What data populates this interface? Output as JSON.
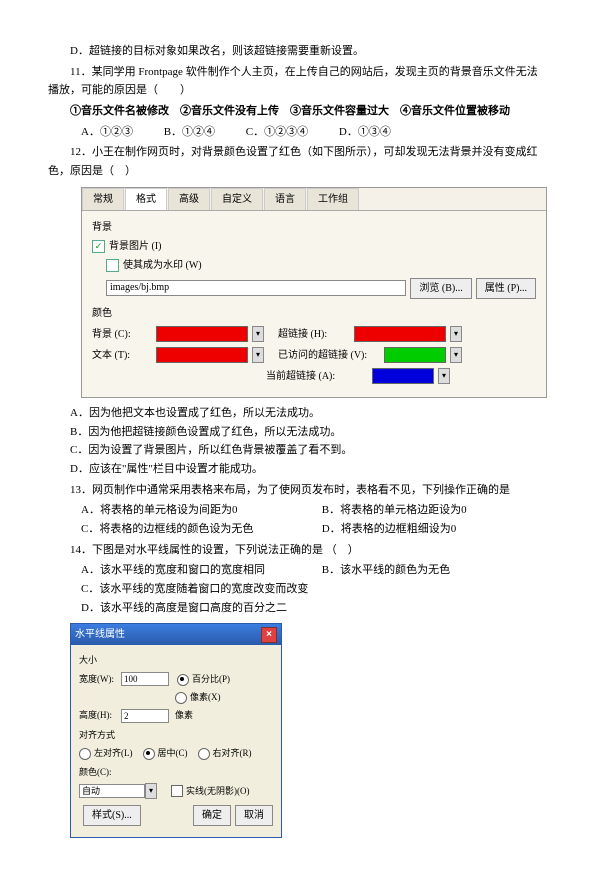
{
  "q10_d": "D．超链接的目标对象如果改名，则该超链接需要重新设置。",
  "q11": "11．某同学用 Frontpage 软件制作个人主页，在上传自己的网站后，发现主页的背景音乐文件无法播放，可能的原因是（　　）",
  "q11_conds": "①音乐文件名被修改　②音乐文件没有上传　③音乐文件容量过大　④音乐文件位置被移动",
  "q11a": "A．①②③",
  "q11b": "B．①②④",
  "q11c": "C．①②③④",
  "q11d": "D．①③④",
  "q12": "12．小王在制作网页时，对背景颜色设置了红色（如下图所示），可却发现无法背景并没有变成红色，原因是（　）",
  "tabs": {
    "t1": "常规",
    "t2": "格式",
    "t3": "高级",
    "t4": "自定义",
    "t5": "语言",
    "t6": "工作组"
  },
  "pane": {
    "sec": "背景",
    "chk1": "背景图片 (I)",
    "chk2": "使其成为水印 (W)",
    "img": "images/bj.bmp",
    "browse": "浏览 (B)...",
    "prop": "属性 (P)...",
    "colors": "颜色",
    "bg": "背景 (C):",
    "hl": "超链接 (H):",
    "txt": "文本 (T):",
    "vis": "已访问的超链接 (V):",
    "act": "当前超链接 (A):"
  },
  "q12a": "A．因为他把文本也设置成了红色，所以无法成功。",
  "q12b": "B．因为他把超链接颜色设置成了红色，所以无法成功。",
  "q12c": "C．因为设置了背景图片，所以红色背景被覆盖了看不到。",
  "q12d": "D．应该在\"属性\"栏目中设置才能成功。",
  "q13": "13．网页制作中通常采用表格来布局，为了使网页发布时，表格看不见，下列操作正确的是",
  "q13a": "A．将表格的单元格设为间距为0",
  "q13b": "B．将表格的单元格边距设为0",
  "q13c": "C．将表格的边框线的颜色设为无色",
  "q13d": "D．将表格的边框粗细设为0",
  "q14": "14．下图是对水平线属性的设置，下列说法正确的是 （　）",
  "q14a": "A．该水平线的宽度和窗口的宽度相同",
  "q14b": "B．该水平线的颜色为无色",
  "q14c": "C．该水平线的宽度随着窗口的宽度改变而改变",
  "q14d": "D．该水平线的高度是窗口高度的百分之二",
  "dlg": {
    "title": "水平线属性",
    "size": "大小",
    "width": "宽度(W):",
    "wv": "100",
    "pct": "百分比(P)",
    "px": "像素(X)",
    "height": "高度(H):",
    "hv": "2",
    "align": "对齐方式",
    "l": "左对齐(L)",
    "c": "居中(C)",
    "r": "右对齐(R)",
    "color": "颜色(C):",
    "auto": "自动",
    "solid": "实线(无阴影)(O)",
    "style": "样式(S)...",
    "ok": "确定",
    "cancel": "取消"
  }
}
